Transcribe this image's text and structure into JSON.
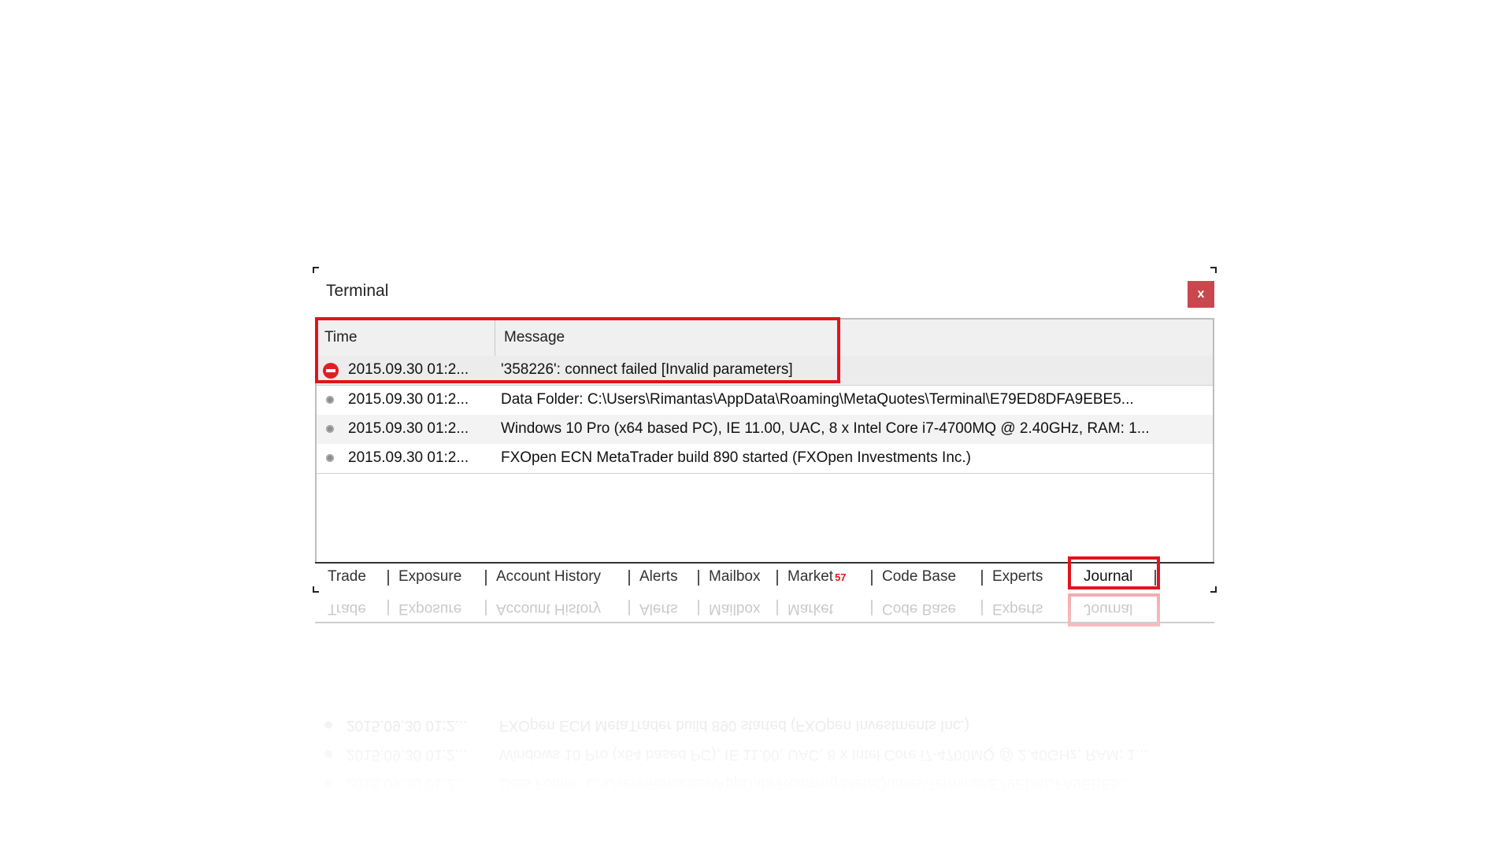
{
  "window": {
    "title": "Terminal",
    "close_label": "x"
  },
  "columns": {
    "time": "Time",
    "message": "Message"
  },
  "rows": [
    {
      "icon": "error-icon",
      "time": "2015.09.30 01:2...",
      "message": "'358226': connect failed [Invalid parameters]"
    },
    {
      "icon": "info-dot-icon",
      "time": "2015.09.30 01:2...",
      "message": "Data Folder: C:\\Users\\Rimantas\\AppData\\Roaming\\MetaQuotes\\Terminal\\E79ED8DFA9EBE5..."
    },
    {
      "icon": "info-dot-icon",
      "time": "2015.09.30 01:2...",
      "message": "Windows 10 Pro (x64 based PC), IE 11.00, UAC, 8 x Intel Core i7-4700MQ  @ 2.40GHz, RAM: 1..."
    },
    {
      "icon": "info-dot-icon",
      "time": "2015.09.30 01:2...",
      "message": "FXOpen ECN MetaTrader build 890 started (FXOpen Investments Inc.)"
    }
  ],
  "tabs": [
    {
      "label": "Trade"
    },
    {
      "label": "Exposure"
    },
    {
      "label": "Account History"
    },
    {
      "label": "Alerts"
    },
    {
      "label": "Mailbox"
    },
    {
      "label": "Market",
      "badge": "57"
    },
    {
      "label": "Code Base"
    },
    {
      "label": "Experts"
    },
    {
      "label": "Journal",
      "active": true
    }
  ],
  "colors": {
    "highlight": "#e0141d",
    "close_button": "#c9484d",
    "error_icon": "#e01e25"
  }
}
